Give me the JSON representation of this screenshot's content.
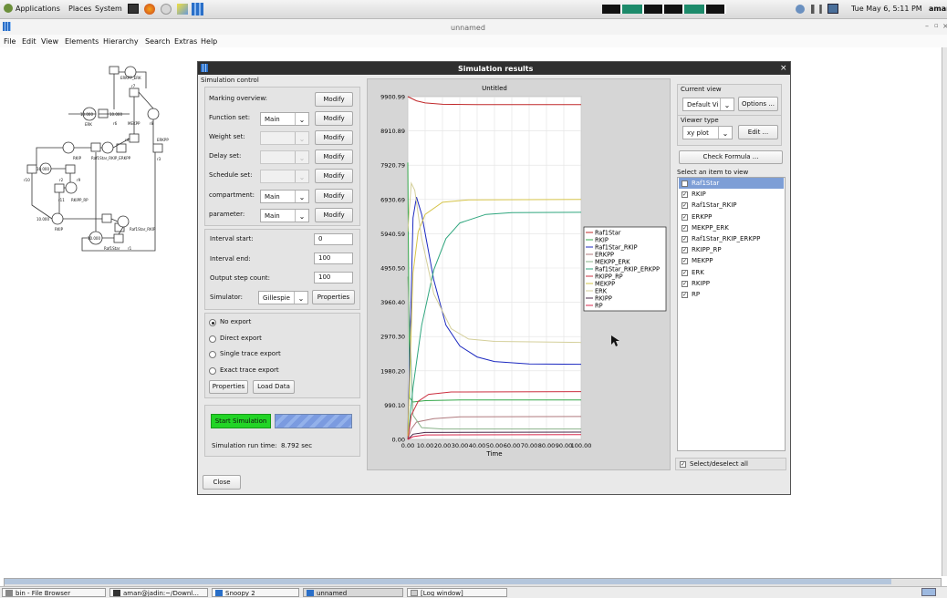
{
  "top_panel": {
    "menus": [
      "Applications",
      "Places",
      "System"
    ],
    "clock": "Tue May 6, 5:11 PM",
    "user": "amar"
  },
  "app": {
    "window_title": "unnamed",
    "menu": [
      "File",
      "Edit",
      "View",
      "Elements",
      "Hierarchy",
      "Search",
      "Extras",
      "Help"
    ]
  },
  "petri_net": {
    "labels": [
      "ERKPP_ERK",
      "r7",
      "10.000",
      "ERK",
      "r6",
      "MEKPP",
      "r8",
      "10.000",
      "r4",
      "ERKPP",
      "RKIP",
      "Raf1Star_RKIP_ERKPP",
      "r3",
      "10.000",
      "r10",
      "r9",
      "r2",
      "r11",
      "RKIPP_RP",
      "10.000",
      "RKIP",
      "Raf1Star_RKIP",
      "10.000",
      "Raf1Star",
      "r1"
    ]
  },
  "dialog": {
    "title": "Simulation results",
    "close_glyph": "×",
    "close_button": "Close",
    "sim_control": {
      "title": "Simulation control",
      "rows": [
        {
          "label": "Marking overview:",
          "combo": "",
          "button": "Modify"
        },
        {
          "label": "Function set:",
          "combo": "Main",
          "button": "Modify"
        },
        {
          "label": "Weight set:",
          "combo": "",
          "button": "Modify"
        },
        {
          "label": "Delay set:",
          "combo": "",
          "button": "Modify"
        },
        {
          "label": "Schedule set:",
          "combo": "",
          "button": "Modify"
        },
        {
          "label": "compartment:",
          "combo": "Main",
          "button": "Modify"
        },
        {
          "label": "parameter:",
          "combo": "Main",
          "button": "Modify"
        }
      ],
      "interval_start_label": "Interval start:",
      "interval_start": "0",
      "interval_end_label": "Interval end:",
      "interval_end": "100",
      "output_step_label": "Output step count:",
      "output_step": "100",
      "simulator_label": "Simulator:",
      "simulator": "Gillespie",
      "properties_button": "Properties",
      "export_options": [
        "No export",
        "Direct export",
        "Single trace export",
        "Exact trace export"
      ],
      "export_selected": 0,
      "export_properties_button": "Properties",
      "load_data_button": "Load Data",
      "start_button": "Start Simulation",
      "progress": 1.0,
      "run_time_label": "Simulation run time:",
      "run_time": "8.792 sec"
    },
    "right_panel": {
      "current_view_title": "Current view",
      "current_view": "Default Vi",
      "options_button": "Options ...",
      "viewer_type_title": "Viewer type",
      "viewer_type": "xy plot",
      "edit_button": "Edit ...",
      "check_formula_button": "Check Formula ...",
      "select_title": "Select an item to view",
      "items": [
        "Raf1Star",
        "RKIP",
        "Raf1Star_RKIP",
        "ERKPP",
        "MEKPP_ERK",
        "Raf1Star_RKIP_ERKPP",
        "RKIPP_RP",
        "MEKPP",
        "ERK",
        "RKIPP",
        "RP"
      ],
      "selected_index": 0,
      "select_all_label": "Select/deselect all"
    }
  },
  "chart_data": {
    "type": "line",
    "title": "Untitled",
    "xlabel": "Time",
    "ylabel": "",
    "xlim": [
      0,
      100
    ],
    "ylim": [
      0,
      9900.99
    ],
    "x_tick_labels": [
      "0.00",
      "10.00",
      "20.00",
      "30.00",
      "40.00",
      "50.00",
      "60.00",
      "70.00",
      "80.00",
      "90.00",
      "100.00"
    ],
    "y_tick_labels": [
      "0.00",
      "990.10",
      "1980.20",
      "2970.30",
      "3960.40",
      "4950.50",
      "5940.59",
      "6930.69",
      "7920.79",
      "8910.89",
      "9900.99"
    ],
    "grid": true,
    "legend_position": "right-outside",
    "series": [
      {
        "name": "Raf1Star",
        "color": "#c0282a",
        "values": [
          [
            0,
            9900
          ],
          [
            5,
            9780
          ],
          [
            10,
            9720
          ],
          [
            20,
            9680
          ],
          [
            40,
            9670
          ],
          [
            100,
            9670
          ]
        ]
      },
      {
        "name": "RKIP",
        "color": "#36a84c",
        "values": [
          [
            0,
            8000
          ],
          [
            1,
            1200
          ],
          [
            3,
            1080
          ],
          [
            10,
            1120
          ],
          [
            30,
            1140
          ],
          [
            100,
            1140
          ]
        ]
      },
      {
        "name": "Raf1Star_RKIP",
        "color": "#1d2ac0",
        "values": [
          [
            0,
            100
          ],
          [
            3,
            6400
          ],
          [
            5,
            7000
          ],
          [
            8,
            6500
          ],
          [
            15,
            4600
          ],
          [
            22,
            3300
          ],
          [
            30,
            2700
          ],
          [
            40,
            2380
          ],
          [
            50,
            2250
          ],
          [
            70,
            2180
          ],
          [
            100,
            2170
          ]
        ]
      },
      {
        "name": "ERKPP",
        "color": "#b07a7e",
        "values": [
          [
            0,
            0
          ],
          [
            2,
            300
          ],
          [
            5,
            500
          ],
          [
            15,
            600
          ],
          [
            30,
            650
          ],
          [
            100,
            660
          ]
        ]
      },
      {
        "name": "MEKPP_ERK",
        "color": "#8ab38a",
        "values": [
          [
            0,
            4700
          ],
          [
            3,
            700
          ],
          [
            8,
            340
          ],
          [
            20,
            300
          ],
          [
            100,
            300
          ]
        ]
      },
      {
        "name": "Raf1Star_RKIP_ERKPP",
        "color": "#2fa67e",
        "values": [
          [
            0,
            0
          ],
          [
            3,
            1500
          ],
          [
            8,
            3300
          ],
          [
            15,
            4900
          ],
          [
            22,
            5800
          ],
          [
            30,
            6250
          ],
          [
            45,
            6500
          ],
          [
            60,
            6550
          ],
          [
            100,
            6560
          ]
        ]
      },
      {
        "name": "RKIPP_RP",
        "color": "#cc3040",
        "values": [
          [
            0,
            0
          ],
          [
            2,
            700
          ],
          [
            6,
            1100
          ],
          [
            12,
            1300
          ],
          [
            25,
            1370
          ],
          [
            100,
            1380
          ]
        ]
      },
      {
        "name": "MEKPP",
        "color": "#d6c44a",
        "values": [
          [
            0,
            100
          ],
          [
            3,
            4800
          ],
          [
            6,
            6000
          ],
          [
            10,
            6500
          ],
          [
            20,
            6850
          ],
          [
            35,
            6920
          ],
          [
            100,
            6930
          ]
        ]
      },
      {
        "name": "ERK",
        "color": "#d4cf9a",
        "values": [
          [
            0,
            6000
          ],
          [
            2,
            7400
          ],
          [
            4,
            7200
          ],
          [
            8,
            5800
          ],
          [
            15,
            4200
          ],
          [
            25,
            3200
          ],
          [
            35,
            2900
          ],
          [
            50,
            2830
          ],
          [
            100,
            2800
          ]
        ]
      },
      {
        "name": "RKIPP",
        "color": "#4a2a4a",
        "values": [
          [
            0,
            0
          ],
          [
            3,
            150
          ],
          [
            10,
            200
          ],
          [
            100,
            210
          ]
        ]
      },
      {
        "name": "RP",
        "color": "#d8284c",
        "values": [
          [
            0,
            0
          ],
          [
            3,
            80
          ],
          [
            10,
            130
          ],
          [
            100,
            140
          ]
        ]
      }
    ]
  }
}
